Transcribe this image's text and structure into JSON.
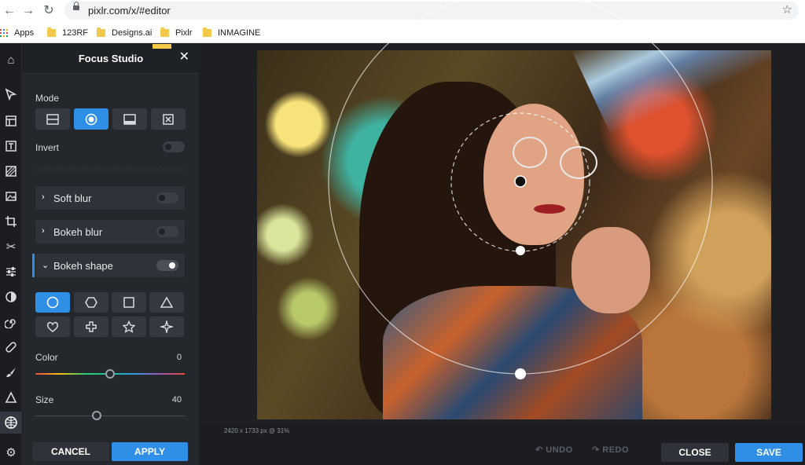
{
  "browser": {
    "url": "pixlr.com/x/#editor",
    "bookmarks": [
      {
        "label": "Apps"
      },
      {
        "label": "123RF"
      },
      {
        "label": "Designs.ai"
      },
      {
        "label": "Pixlr"
      },
      {
        "label": "INMAGINE"
      }
    ]
  },
  "panel": {
    "title": "Focus Studio",
    "mode_label": "Mode",
    "invert_label": "Invert",
    "sections": {
      "soft_blur": "Soft blur",
      "bokeh_blur": "Bokeh blur",
      "bokeh_shape": "Bokeh shape"
    },
    "color_label": "Color",
    "color_value": "0",
    "size_label": "Size",
    "size_value": "40",
    "cancel": "CANCEL",
    "apply": "APPLY"
  },
  "status": {
    "image_info": "2420 x 1733 px @ 31%"
  },
  "bottom": {
    "undo": "UNDO",
    "redo": "REDO",
    "close": "CLOSE",
    "save": "SAVE"
  },
  "colors": {
    "accent": "#2f8ee6",
    "panel_bg": "#24272c",
    "toolbar_bg": "#1b1d21"
  }
}
